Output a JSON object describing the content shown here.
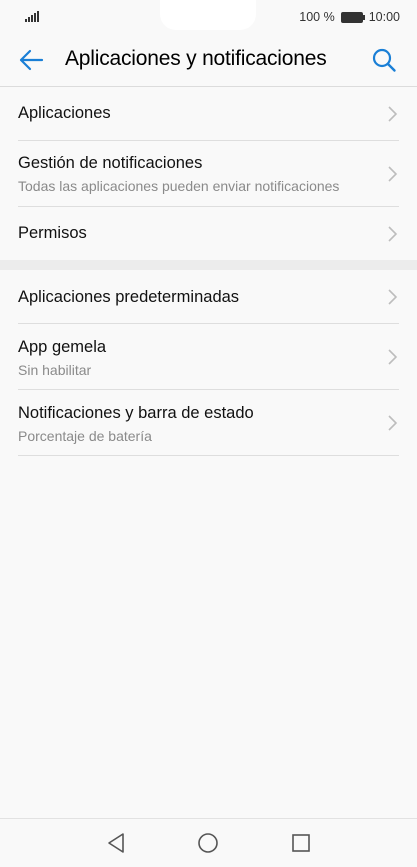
{
  "status_bar": {
    "battery_percent": "100 %",
    "time": "10:00",
    "icons": [
      "signal-icon",
      "battery-icon"
    ]
  },
  "header": {
    "title": "Aplicaciones y notificaciones",
    "back_icon": "arrow-left-icon",
    "search_icon": "search-icon"
  },
  "colors": {
    "accent": "#1a7fd6",
    "background": "#f9f9f9",
    "secondary_text": "#8a8a8a"
  },
  "sections": [
    {
      "items": [
        {
          "label": "Aplicaciones",
          "subtitle": ""
        },
        {
          "label": "Gestión de notificaciones",
          "subtitle": "Todas las aplicaciones pueden enviar notificaciones"
        },
        {
          "label": "Permisos",
          "subtitle": ""
        }
      ]
    },
    {
      "items": [
        {
          "label": "Aplicaciones predeterminadas",
          "subtitle": ""
        },
        {
          "label": "App gemela",
          "subtitle": "Sin habilitar"
        },
        {
          "label": "Notificaciones y barra de estado",
          "subtitle": "Porcentaje de batería"
        }
      ]
    }
  ],
  "nav_bar": {
    "icons": [
      "back-triangle-icon",
      "home-circle-icon",
      "recents-square-icon"
    ]
  }
}
